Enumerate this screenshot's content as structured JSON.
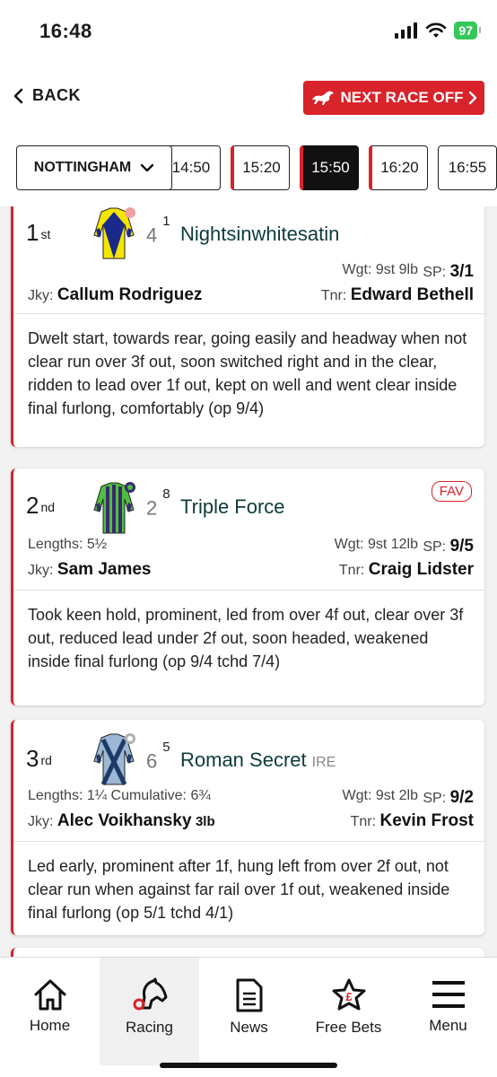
{
  "status_bar": {
    "time": "16:48",
    "battery": "97"
  },
  "header": {
    "back_label": "BACK",
    "next_race_label": "NEXT RACE OFF"
  },
  "race_nav": {
    "course": "NOTTINGHAM",
    "times": [
      "14:50",
      "15:20",
      "15:50",
      "16:20",
      "16:55"
    ],
    "active_time": "15:50"
  },
  "colors": {
    "accent": "#d8232a",
    "horse_name": "#0d3b3b"
  },
  "runners": [
    {
      "position": "1",
      "position_suffix": "st",
      "cloth_number": "4",
      "draw": "1",
      "horse": "Nightsinwhitesatin",
      "origin": "",
      "lengths": "",
      "weight_label": "Wgt:",
      "weight": "9st 9lb",
      "sp_label": "SP:",
      "sp": "3/1",
      "jockey_label": "Jky:",
      "jockey": "Callum Rodriguez",
      "jockey_claim": "",
      "trainer_label": "Tnr:",
      "trainer": "Edward Bethell",
      "favourite": false,
      "comment": "Dwelt start, towards rear, going easily and headway when not clear run over 3f out, soon switched right and in the clear, ridden to lead over 1f out, kept on well and went clear inside final furlong, comfortably (op 9/4)"
    },
    {
      "position": "2",
      "position_suffix": "nd",
      "cloth_number": "2",
      "draw": "8",
      "horse": "Triple Force",
      "origin": "",
      "lengths": "Lengths: 5½",
      "weight_label": "Wgt:",
      "weight": "9st 12lb",
      "sp_label": "SP:",
      "sp": "9/5",
      "jockey_label": "Jky:",
      "jockey": "Sam James",
      "jockey_claim": "",
      "trainer_label": "Tnr:",
      "trainer": "Craig Lidster",
      "favourite": true,
      "favourite_label": "FAV",
      "comment": "Took keen hold, prominent, led from over 4f out, clear over 3f out, reduced lead under 2f out, soon headed, weakened inside final furlong (op 9/4 tchd 7/4)"
    },
    {
      "position": "3",
      "position_suffix": "rd",
      "cloth_number": "6",
      "draw": "5",
      "horse": "Roman Secret",
      "origin": "IRE",
      "lengths": "Lengths: 1¼ Cumulative: 6¾",
      "weight_label": "Wgt:",
      "weight": "9st 2lb",
      "sp_label": "SP:",
      "sp": "9/2",
      "jockey_label": "Jky:",
      "jockey": "Alec Voikhansky",
      "jockey_claim": "3lb",
      "trainer_label": "Tnr:",
      "trainer": "Kevin Frost",
      "favourite": false,
      "comment": "Led early, prominent after 1f, hung left from over 2f out, not clear run when against far rail over 1f out, weakened inside final furlong (op 5/1 tchd 4/1)"
    }
  ],
  "bottom_nav": [
    {
      "label": "Home",
      "icon": "home-icon"
    },
    {
      "label": "Racing",
      "icon": "horse-head-icon"
    },
    {
      "label": "News",
      "icon": "document-icon"
    },
    {
      "label": "Free Bets",
      "icon": "star-pound-icon"
    },
    {
      "label": "Menu",
      "icon": "hamburger-menu-icon"
    }
  ]
}
